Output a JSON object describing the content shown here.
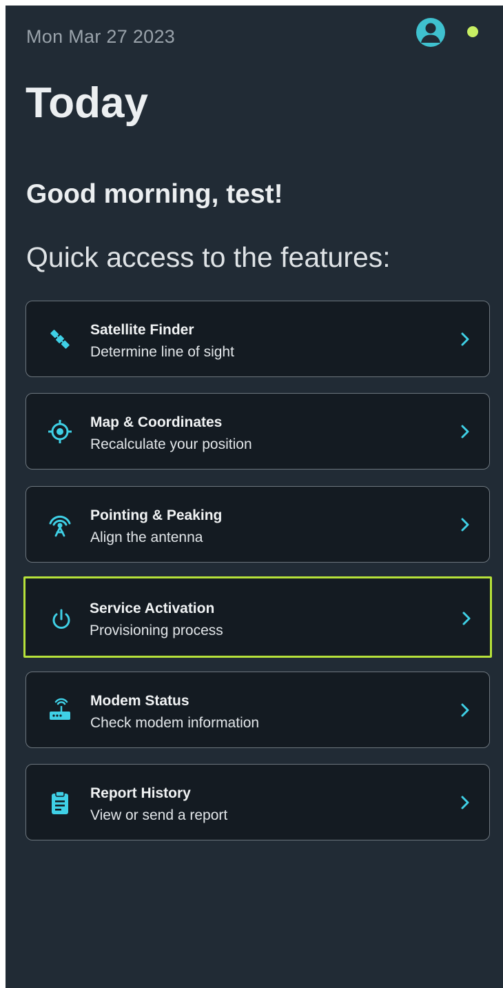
{
  "header": {
    "date": "Mon Mar 27 2023",
    "profile_icon": "account-circle-icon",
    "status_color": "#c8ef63"
  },
  "page": {
    "title": "Today",
    "greeting": "Good morning, test!",
    "section_heading": "Quick access to the features:"
  },
  "accent_color": "#3fd0e6",
  "selected_color": "#b7e23a",
  "features": [
    {
      "title": "Satellite Finder",
      "subtitle": "Determine line of sight",
      "icon": "satellite-icon"
    },
    {
      "title": "Map & Coordinates",
      "subtitle": "Recalculate your position",
      "icon": "crosshair-location-icon"
    },
    {
      "title": "Pointing & Peaking",
      "subtitle": "Align the antenna",
      "icon": "antenna-icon"
    },
    {
      "title": "Service Activation",
      "subtitle": "Provisioning process",
      "icon": "power-icon",
      "selected": true
    },
    {
      "title": "Modem Status",
      "subtitle": "Check modem information",
      "icon": "router-icon"
    },
    {
      "title": "Report History",
      "subtitle": "View or send a report",
      "icon": "clipboard-icon"
    }
  ]
}
